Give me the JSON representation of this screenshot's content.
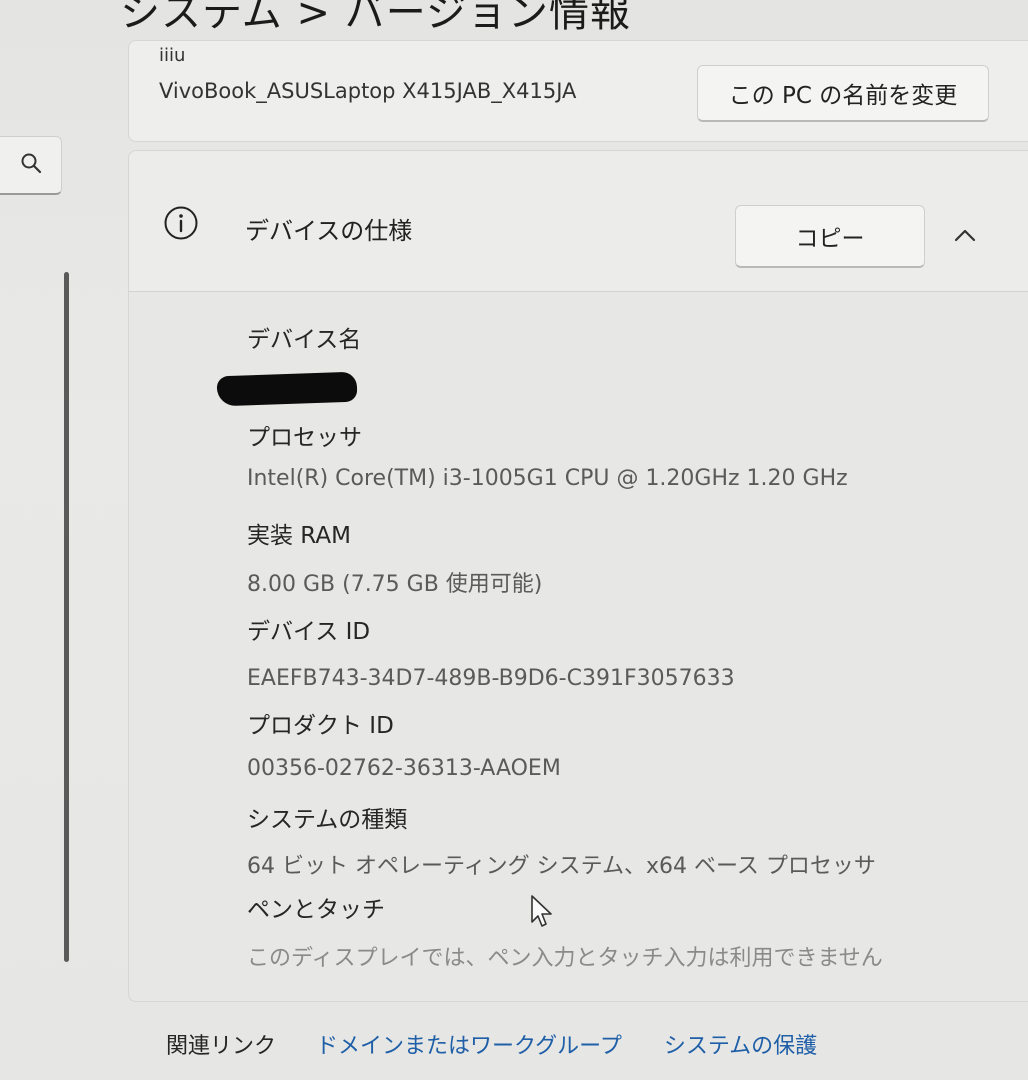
{
  "page": {
    "title": "システム > バージョン情報"
  },
  "device_card": {
    "partial_text": "iiiu",
    "model": "VivoBook_ASUSLaptop X415JAB_X415JA",
    "rename_button": "この PC の名前を変更"
  },
  "spec_card": {
    "title": "デバイスの仕様",
    "copy_button": "コピー",
    "expanded": true,
    "items": [
      {
        "label": "デバイス名",
        "value": ""
      },
      {
        "label": "プロセッサ",
        "value": "Intel(R) Core(TM) i3-1005G1 CPU @ 1.20GHz   1.20 GHz"
      },
      {
        "label": "実装 RAM",
        "value": "8.00 GB (7.75 GB 使用可能)"
      },
      {
        "label": "デバイス ID",
        "value": "EAEFB743-34D7-489B-B9D6-C391F3057633"
      },
      {
        "label": "プロダクト ID",
        "value": "00356-02762-36313-AAOEM"
      },
      {
        "label": "システムの種類",
        "value": "64 ビット オペレーティング システム、x64 ベース プロセッサ"
      },
      {
        "label": "ペンとタッチ",
        "value": "このディスプレイでは、ペン入力とタッチ入力は利用できません"
      }
    ]
  },
  "related_links": {
    "label": "関連リンク",
    "links": [
      "ドメインまたはワークグループ",
      "システムの保護"
    ]
  },
  "colors": {
    "background": "#e6e6e4",
    "card": "#eeeeec",
    "link": "#1f5fa8",
    "value_text": "#5a5a5a"
  },
  "icons": {
    "search": "search-icon",
    "info": "info-icon",
    "collapse": "chevron-up-icon",
    "pointer": "cursor-icon"
  }
}
